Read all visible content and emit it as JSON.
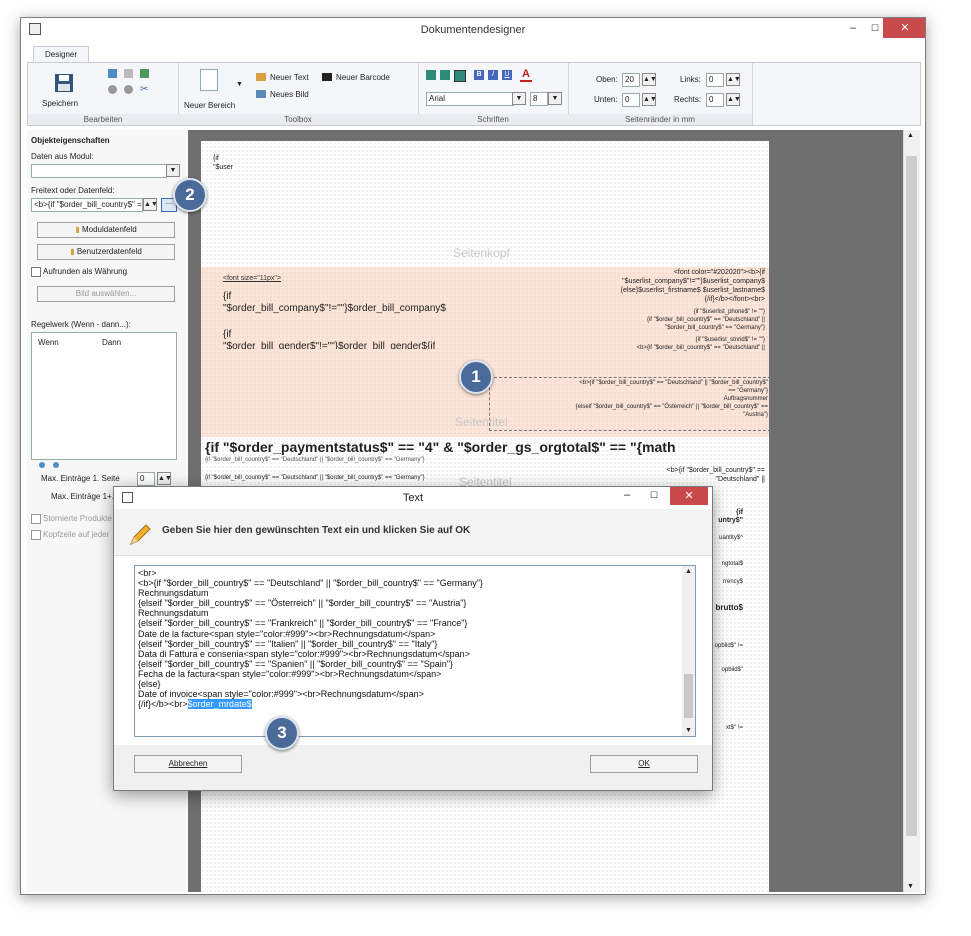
{
  "window": {
    "title": "Dokumentendesigner",
    "min": "–",
    "max": "☐",
    "close": "✕"
  },
  "ribbon": {
    "tab": "Designer",
    "groups": {
      "bearbeiten": {
        "label": "Bearbeiten",
        "save": "Speichern"
      },
      "toolbox": {
        "label": "Toolbox",
        "new_area": "Neuer Bereich",
        "new_text": "Neuer Text",
        "new_barcode": "Neuer Barcode",
        "new_image": "Neues Bild"
      },
      "schriften": {
        "label": "Schriften",
        "font": "Arial",
        "size": "8"
      },
      "margins": {
        "label": "Seitenränder in mm",
        "top_label": "Oben:",
        "top_val": "20",
        "bottom_label": "Unten:",
        "bottom_val": "0",
        "left_label": "Links:",
        "left_val": "0",
        "right_label": "Rechts:",
        "right_val": "0"
      }
    }
  },
  "left": {
    "title": "Objekteigenschaften",
    "data_from_module": "Daten aus Modul:",
    "freetext_label": "Freitext oder Datenfeld:",
    "freetext_value": "<b>{if \"$order_bill_country$\" =",
    "more": "....",
    "module_field": "Moduldatenfeld",
    "user_field": "Benutzerdatenfeld",
    "round_currency": "Aufrunden als Währung",
    "select_image": "Bild auswählen...",
    "rules_label": "Regelwerk (Wenn - dann...):",
    "col_wenn": "Wenn",
    "col_dann": "Dann",
    "max_first": "Max. Einträge 1. Seite",
    "max_first_val": "0",
    "max_next": "Max. Einträge 1+.",
    "storno": "Stornierte Produkte",
    "header_each": "Kopfzeile auf jeder"
  },
  "canvas": {
    "top_text1": "{if",
    "top_text2": "\"$user",
    "band_header": "Seitenkopf",
    "font_tag": "<font size=\"11px\">",
    "left_if1": "{if",
    "left_cond1": "\"$order_bill_company$\"!=\"\"}$order_bill_company$",
    "left_if2": "{if",
    "left_cond2": "\"$order_bill_gender$\"!=\"\"}$order_bill_gender${if",
    "r1": "<font color=\"#202020\"><b>{if",
    "r2": "\"$userlist_company$\"!=\"\"}$userlist_company$",
    "r3": "{else}$userlist_firstname$ $userlist_lastname$",
    "r4": "{/if}</b></font><br>",
    "r5": "{if \"$userlist_phone$\" != \"\"}",
    "r6": "{if \"$order_bill_country$\" == \"Deutschland\" ||",
    "r7": "\"$order_bill_country$\" == \"Germany\"}",
    "r8": "{if \"$userlist_stnrid$\" != \"\"}",
    "r9": "<b>{if \"$order_bill_country$\" == \"Deutschland\" ||",
    "sel1": "<b>{if \"$order_bill_country$\" == \"Deutschland\" || \"$order_bill_country$\"",
    "sel2": "== \"Germany\"}",
    "sel3": "Auftragsnummer",
    "sel4": "{elseif \"$order_bill_country$\" == \"Österreich\" || \"$order_bill_country$\" ==",
    "sel5": "\"Austria\"}",
    "band_title": "Seitentitel",
    "big": "{if \"$order_paymentstatus$\" == \"4\" & \"$order_gs_orgtotal$\" == \"{math",
    "small1": "{if \"$order_bill_country$\" == \"Deutschland\" || \"$order_bill_country$\" == \"Germany\"}",
    "small2": "{if \"$order_bill_country$\" == \"Deutschland\" || \"$order_bill_country$\" == \"Germany\"}",
    "small3": "Lieferanschrift",
    "rs1": "<b>{if \"$order_bill_country$\" ==",
    "rs2": "\"Deutschland\" ||",
    "band_title2": "Seitentitel",
    "p1": "{if",
    "p2": "untry$\"",
    "p3": "uantity$^",
    "p4": "ngtotal$",
    "p5": "rrency$",
    "p6": "brutto$",
    "p7": "opbild$\" !=",
    "p8": "opbild$\"",
    "p9": "xt$\" !="
  },
  "dialog": {
    "title": "Text",
    "prompt": "Geben Sie hier den gewünschten Text ein und klicken Sie auf OK",
    "lines": [
      "<br>",
      "<b>{if \"$order_bill_country$\" == \"Deutschland\" || \"$order_bill_country$\" == \"Germany\"}",
      "Rechnungsdatum",
      "{elseif \"$order_bill_country$\" == \"Österreich\" || \"$order_bill_country$\" == \"Austria\"}",
      "Rechnungsdatum",
      "{elseif \"$order_bill_country$\" == \"Frankreich\" || \"$order_bill_country$\" == \"France\"}",
      "Date de la facture<span style=\"color:#999\"><br>Rechnungsdatum</span>",
      "{elseif \"$order_bill_country$\" == \"Italien\" || \"$order_bill_country$\" == \"Italy\"}",
      "Data di Fattura e consenia<span style=\"color:#999\"><br>Rechnungsdatum</span>",
      "{elseif \"$order_bill_country$\" == \"Spanien\" || \"$order_bill_country$\" == \"Spain\"}",
      "Fecha de la factura<span style=\"color:#999\"><br>Rechnungsdatum</span>",
      "{else}",
      "Date of invoice<span style=\"color:#999\"><br>Rechnungsdatum</span>"
    ],
    "last_prefix": "{/if}</b><br>",
    "last_selected": "$order_mrdate$",
    "cancel": "Abbrechen",
    "ok": "OK"
  },
  "badges": {
    "b1": "1",
    "b2": "2",
    "b3": "3"
  },
  "colors": {
    "accent": "#4a6a9a",
    "close_red": "#c94a4a",
    "band": "#fbe4d8",
    "selection": "#3399ff"
  }
}
